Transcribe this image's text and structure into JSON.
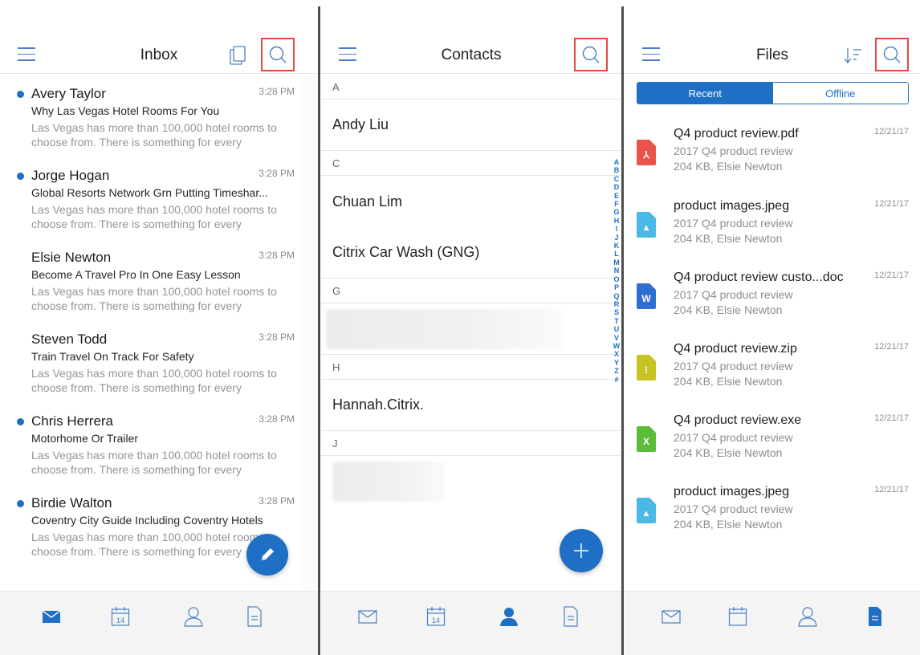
{
  "inbox": {
    "title": "Inbox",
    "messages": [
      {
        "sender": "Avery Taylor",
        "time": "3:28 PM",
        "subject": "Why Las Vegas Hotel Rooms For You",
        "preview": "Las Vegas has more than 100,000 hotel rooms to choose from. There is something for every",
        "unread": true
      },
      {
        "sender": "Jorge Hogan",
        "time": "3:28 PM",
        "subject": "Global Resorts Network Grn Putting Timeshar...",
        "preview": "Las Vegas has more than 100,000 hotel rooms to choose from. There is something for every",
        "unread": true
      },
      {
        "sender": "Elsie Newton",
        "time": "3:28 PM",
        "subject": "Become A Travel Pro In One Easy Lesson",
        "preview": "Las Vegas has more than 100,000 hotel rooms to choose from. There is something for every",
        "unread": false
      },
      {
        "sender": "Steven Todd",
        "time": "3:28 PM",
        "subject": "Train Travel On Track For Safety",
        "preview": "Las Vegas has more than 100,000 hotel rooms to choose from. There is something for every",
        "unread": false
      },
      {
        "sender": "Chris Herrera",
        "time": "3:28 PM",
        "subject": "Motorhome Or Trailer",
        "preview": "Las Vegas has more than 100,000 hotel rooms to choose from. There is something for every",
        "unread": true
      },
      {
        "sender": "Birdie Walton",
        "time": "3:28 PM",
        "subject": "Coventry City Guide Including Coventry Hotels",
        "preview": "Las Vegas has more than 100,000 hotel rooms to choose from. There is something for every",
        "unread": true
      }
    ]
  },
  "contacts": {
    "title": "Contacts",
    "sections": [
      {
        "letter": "A",
        "names": [
          "Andy Liu"
        ]
      },
      {
        "letter": "C",
        "names": [
          "Chuan Lim",
          "Citrix Car Wash (GNG)"
        ]
      },
      {
        "letter": "G",
        "names": []
      },
      {
        "letter": "H",
        "names": [
          "Hannah.Citrix."
        ]
      },
      {
        "letter": "J",
        "names": []
      }
    ],
    "index_letters": [
      "A",
      "B",
      "C",
      "D",
      "E",
      "F",
      "G",
      "H",
      "I",
      "J",
      "K",
      "L",
      "M",
      "N",
      "O",
      "P",
      "Q",
      "R",
      "S",
      "T",
      "U",
      "V",
      "W",
      "X",
      "Y",
      "Z",
      "#"
    ]
  },
  "files": {
    "title": "Files",
    "segments": {
      "recent": "Recent",
      "offline": "Offline"
    },
    "items": [
      {
        "name": "Q4 product review.pdf",
        "desc": "2017 Q4 product review",
        "meta": "204 KB, Elsie Newton",
        "date": "12/21/17",
        "icon": "pdf-file-icon",
        "color": "#e8534a",
        "glyph": "⅄"
      },
      {
        "name": "product images.jpeg",
        "desc": "2017 Q4 product review",
        "meta": "204 KB, Elsie Newton",
        "date": "12/21/17",
        "icon": "image-file-icon",
        "color": "#4ab9e6",
        "glyph": "▴"
      },
      {
        "name": "Q4 product review custo...doc",
        "desc": "2017 Q4 product review",
        "meta": "204 KB, Elsie Newton",
        "date": "12/21/17",
        "icon": "word-file-icon",
        "color": "#2f6fd1",
        "glyph": "W"
      },
      {
        "name": "Q4 product review.zip",
        "desc": "2017 Q4 product review",
        "meta": "204 KB, Elsie Newton",
        "date": "12/21/17",
        "icon": "zip-file-icon",
        "color": "#c7c323",
        "glyph": "⁝"
      },
      {
        "name": "Q4 product review.exe",
        "desc": "2017 Q4 product review",
        "meta": "204 KB, Elsie Newton",
        "date": "12/21/17",
        "icon": "excel-file-icon",
        "color": "#5dbb3a",
        "glyph": "X"
      },
      {
        "name": "product images.jpeg",
        "desc": "2017 Q4 product review",
        "meta": "204 KB, Elsie Newton",
        "date": "12/21/17",
        "icon": "image-file-icon",
        "color": "#4ab9e6",
        "glyph": "▴"
      }
    ]
  },
  "calendar_day": "14",
  "colors": {
    "accent": "#1f6fc5",
    "highlight": "#e8473d",
    "muted": "#8e8e8e"
  }
}
